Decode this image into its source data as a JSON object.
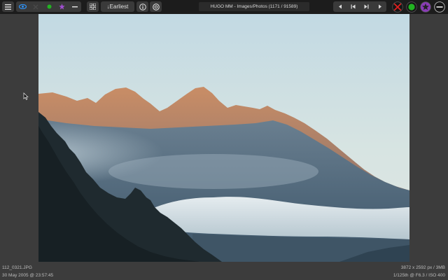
{
  "toolbar": {
    "menu_icon": "hamburger-icon",
    "filter_icons": [
      "eye-icon",
      "x-mark-icon",
      "green-dot-icon",
      "star-icon",
      "minus-icon"
    ],
    "grid_icon": "grid-icon",
    "sort_label": "↓Earliest",
    "info_icon": "info-icon",
    "search_icon": "zoom-icon",
    "title": "HUGO MM - Images/Photos (1171 / 91589)",
    "nav_icons": [
      "prev-icon",
      "first-icon",
      "last-icon",
      "next-icon"
    ],
    "action_icons": [
      "reject-icon",
      "accept-icon",
      "favorite-icon",
      "remove-icon"
    ],
    "colors": {
      "reject": "#e02020",
      "accept": "#22b322",
      "favorite": "#8a3bb8",
      "eye": "#2e8ff0"
    }
  },
  "image": {
    "subject": "mountain peaks above clouds at sunset",
    "info": {
      "filename": "112_0321.JPG",
      "datetime": "30 May 2005 @ 23:57:45",
      "dimensions": "3872 x 2592 px / 3MB",
      "exposure": "1/125th @ F6.3 / ISO 400"
    }
  }
}
